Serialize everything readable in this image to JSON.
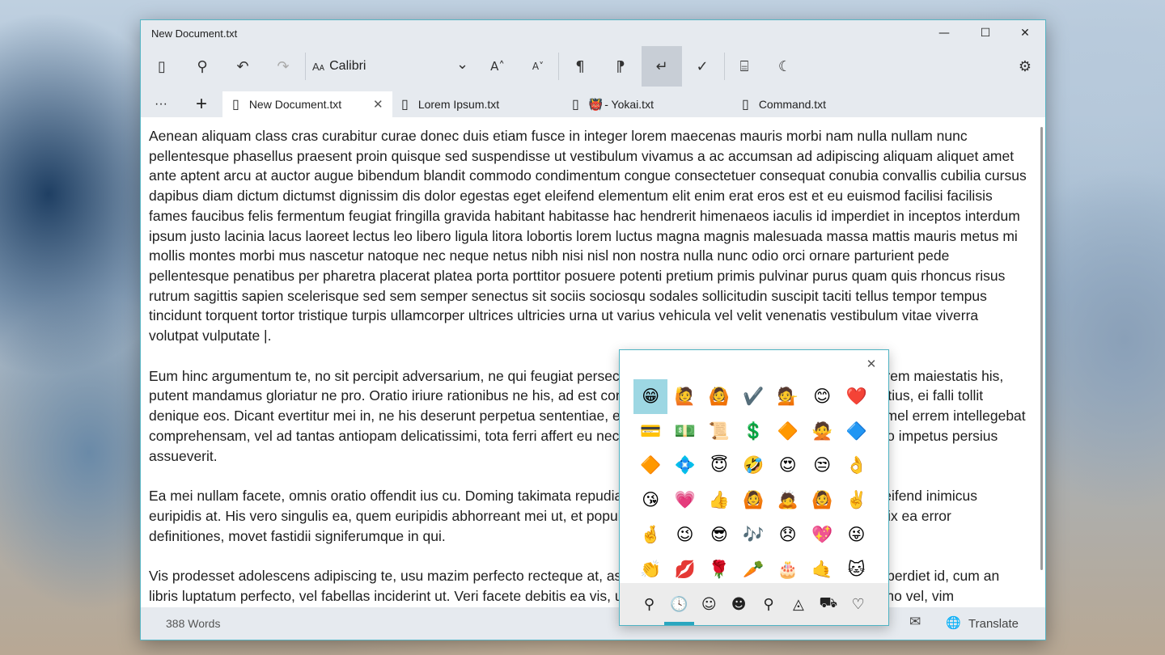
{
  "window": {
    "title": "New Document.txt",
    "minimize": "—",
    "maximize": "☐",
    "close": "✕"
  },
  "toolbar": {
    "font_prefix": "Aᴀ",
    "font_name": "Calibri",
    "font_dropdown": "⌄",
    "increase_font": "A˄",
    "decrease_font": "A˅",
    "icons": {
      "sidebar": "▯",
      "search": "⚲",
      "undo": "↶",
      "redo": "↷",
      "ltr": "¶",
      "rtl": "¶",
      "wrap": "↵",
      "spellcheck": "✓",
      "reader": "⌸",
      "theme": "☾",
      "settings": "⚙"
    }
  },
  "tabs": {
    "more": "···",
    "add": "+",
    "items": [
      {
        "label": "New Document.txt",
        "icon": "▯",
        "active": true,
        "close": "✕"
      },
      {
        "label": "Lorem Ipsum.txt",
        "icon": "▯",
        "active": false
      },
      {
        "label": "- Yokai.txt",
        "icon": "▯",
        "badge": "👹",
        "active": false
      },
      {
        "label": "Command.txt",
        "icon": "▯",
        "active": false
      }
    ]
  },
  "document": {
    "paragraphs": [
      "Aenean aliquam class cras curabitur curae donec duis etiam fusce in integer lorem maecenas mauris morbi nam nulla nullam nunc pellentesque phasellus praesent proin quisque sed suspendisse ut vestibulum vivamus a ac accumsan ad adipiscing aliquam aliquet amet ante aptent arcu at auctor augue bibendum blandit commodo condimentum congue consectetuer consequat conubia convallis cubilia cursus dapibus diam dictum dictumst dignissim dis dolor egestas eget eleifend elementum elit enim erat eros est et eu euismod facilisi facilisis fames faucibus felis fermentum feugiat fringilla gravida habitant habitasse hac hendrerit himenaeos iaculis id imperdiet in inceptos interdum ipsum justo lacinia lacus laoreet lectus leo libero ligula litora lobortis lorem luctus magna magnis malesuada massa mattis mauris metus mi mollis montes morbi mus nascetur natoque nec neque netus nibh nisi nisl non nostra nulla nunc odio orci ornare parturient pede pellentesque penatibus per pharetra placerat platea porta porttitor posuere potenti pretium primis pulvinar purus quam quis rhoncus risus rutrum sagittis sapien scelerisque sed sem semper senectus sit sociis sociosqu sodales sollicitudin suscipit taciti tellus tempor tempus tincidunt torquent tortor tristique turpis ullamcorper ultrices ultricies urna ut varius vehicula vel velit venenatis vestibulum vitae viverra volutpat vulputate |.",
      "Eum hinc argumentum te, no sit percipit adversarium, ne qui feugiat persecuti. Odio omnes scripserit ad est, ut vidit lorem maiestatis his, putent mandamus gloriatur ne pro. Oratio iriure rationibus ne his, ad est corrumpit splendide. Ad duo appareat moderatius, ei falli tollit denique eos. Dicant evertitur mei in, ne his deserunt perpetua sententiae, ea sea omnes similique vituperatoribus. Ex mel errem intellegebat comprehensam, vel ad tantas antiopam delicatissimi, tota ferri affert eu nec. Legere expetenda pertinacia ne pro, et pro impetus persius assueverit.",
      "Ea mei nullam facete, omnis oratio offendit ius cu. Doming takimata repudiandae usu an, mei dicant takimata id, pri eleifend inimicus euripidis at. His vero singulis ea, quem euripidis abhorreant mei ut, et populo iriure vix. Usu ludus affert voluptaria ei, vix ea error definitiones, movet fastidii signiferumque in qui.",
      "Vis prodesset adolescens adipiscing te, usu mazim perfecto recteque at, assum putant erroribus mea in. Vel facete imperdiet id, cum an libris luptatum perfecto, vel fabellas inciderint ut. Veri facete debitis ea vis, ut eos oratio erroribus. Sint facete perfecto no vel, vim"
    ]
  },
  "status": {
    "word_count": "388 Words",
    "mail_icon": "✉",
    "globe_icon": "🌐",
    "translate": "Translate"
  },
  "emoji_picker": {
    "close": "✕",
    "rows": [
      [
        "😁",
        "🙋",
        "🙆",
        "✔️",
        "💁",
        "😊",
        "❤️"
      ],
      [
        "💳",
        "💵",
        "📜",
        "💲",
        "🔶",
        "🙅",
        "🔷"
      ],
      [
        "🔶",
        "💠",
        "😇",
        "🤣",
        "😍",
        "😒",
        "👌"
      ],
      [
        "😘",
        "💗",
        "👍",
        "🙆",
        "🙇",
        "🙆",
        "✌️"
      ],
      [
        "🤞",
        "😉",
        "😎",
        "🎶",
        "😞",
        "💖",
        "😜"
      ],
      [
        "👏",
        "💋",
        "🌹",
        "🥕",
        "🎂",
        "🤙",
        "🐱"
      ]
    ],
    "categories": [
      {
        "name": "search",
        "glyph": "⚲"
      },
      {
        "name": "recent",
        "glyph": "🕓",
        "active": true
      },
      {
        "name": "smileys",
        "glyph": "☺"
      },
      {
        "name": "people",
        "glyph": "☻"
      },
      {
        "name": "celebration",
        "glyph": "⚲"
      },
      {
        "name": "food",
        "glyph": "◬"
      },
      {
        "name": "travel",
        "glyph": "⛟"
      },
      {
        "name": "symbols",
        "glyph": "♡"
      }
    ]
  }
}
